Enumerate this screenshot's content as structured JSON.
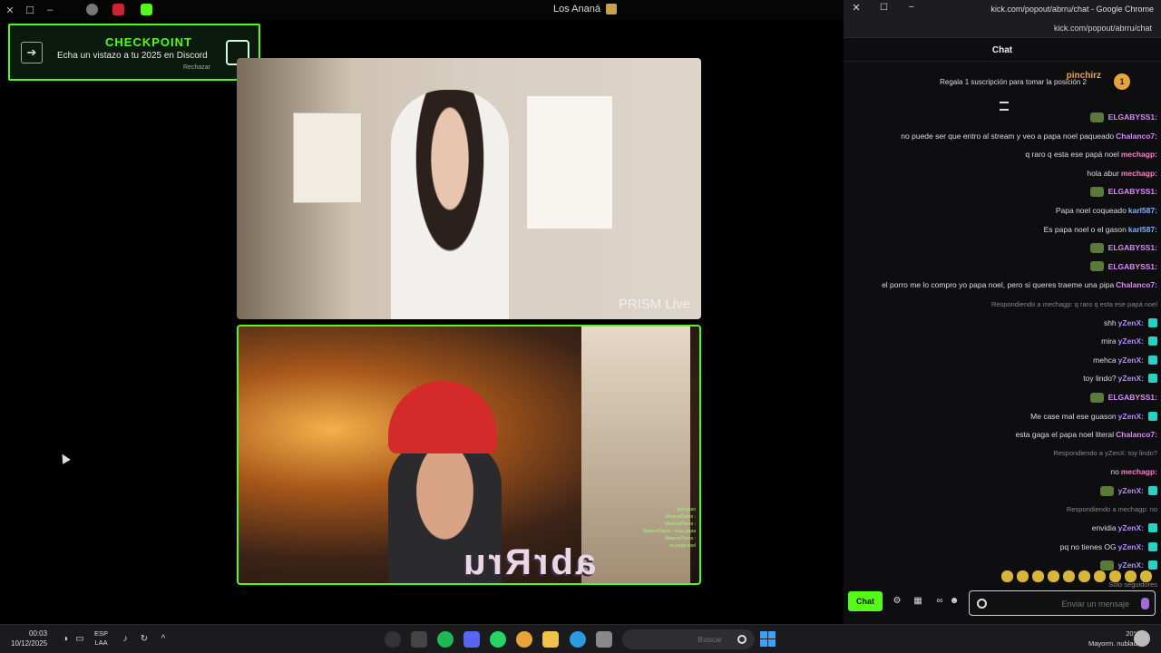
{
  "stream_window": {
    "title": "Los Ananá",
    "checkpoint": {
      "title": "CHECKPOINT",
      "subtitle": "Echa un vistazo a tu 2025 en Discord",
      "dismiss": "Rechazar"
    },
    "prism_label": "PRISM Live",
    "overlay_logo": "abrRru",
    "overlay_chat": [
      "que paso",
      "MaurooFlores :",
      "MaurooFlores :",
      "MaurooFlores : chau papa",
      "MaurooFlores :",
      "es papa noel"
    ]
  },
  "chrome": {
    "title": "kick.com/popout/abrru/chat - Google Chrome",
    "url": "kick.com/popout/abrru/chat"
  },
  "chat": {
    "header": "Chat",
    "gift": {
      "rank": "1",
      "user": "pinchirz",
      "text": "Regala 1 suscripción para tomar la posición 2"
    },
    "messages": [
      {
        "user": "ELGABYSS1:",
        "text": "",
        "emote": true,
        "color": "#d98cff",
        "badge": false
      },
      {
        "user": "Chalanco7:",
        "text": "no puede ser que entro al stream y veo a papa noel paqueado",
        "emote": false,
        "color": "#d98cff",
        "badge": false
      },
      {
        "user": "mechagp:",
        "text": "q raro q esta ese papá noel",
        "emote": false,
        "color": "#ff7ac8",
        "badge": false
      },
      {
        "user": "mechagp:",
        "text": "hola abur",
        "emote": false,
        "color": "#ff7ac8",
        "badge": false
      },
      {
        "user": "ELGABYSS1:",
        "text": "",
        "emote": true,
        "color": "#d98cff",
        "badge": false
      },
      {
        "user": "karl587:",
        "text": "Papa noel coqueado",
        "emote": false,
        "color": "#7fb0ff",
        "badge": false
      },
      {
        "user": "karl587:",
        "text": "Es papa noel o el gason",
        "emote": false,
        "color": "#7fb0ff",
        "badge": false
      },
      {
        "user": "ELGABYSS1:",
        "text": "",
        "emote": true,
        "color": "#d98cff",
        "badge": false
      },
      {
        "user": "ELGABYSS1:",
        "text": "",
        "emote": true,
        "color": "#d98cff",
        "badge": false
      },
      {
        "user": "Chalanco7:",
        "text": "el porro me lo compro yo papa noel, pero si queres traeme una pipa",
        "emote": false,
        "color": "#d98cff",
        "badge": false
      },
      {
        "reply": "Respondiendo a mechagp: q raro q esta ese papá noel"
      },
      {
        "user": "yZenX:",
        "text": "shh",
        "emote": false,
        "color": "#b48cff",
        "badge": true
      },
      {
        "user": "yZenX:",
        "text": "mira",
        "emote": false,
        "color": "#b48cff",
        "badge": true
      },
      {
        "user": "yZenX:",
        "text": "mehca",
        "emote": false,
        "color": "#b48cff",
        "badge": true
      },
      {
        "user": "yZenX:",
        "text": "toy lindo?",
        "emote": false,
        "color": "#b48cff",
        "badge": true
      },
      {
        "user": "ELGABYSS1:",
        "text": "",
        "emote": true,
        "color": "#d98cff",
        "badge": false
      },
      {
        "user": "yZenX:",
        "text": "Me case mal ese guason",
        "emote": false,
        "color": "#b48cff",
        "badge": true
      },
      {
        "user": "Chalanco7:",
        "text": "esta gaga el papa noel literal",
        "emote": false,
        "color": "#d98cff",
        "badge": false
      },
      {
        "reply": "Respondiendo a yZenX: toy lindo?"
      },
      {
        "user": "mechagp:",
        "text": "no",
        "emote": false,
        "color": "#ff7ac8",
        "badge": false
      },
      {
        "user": "yZenX:",
        "text": "",
        "emote": true,
        "color": "#b48cff",
        "badge": true
      },
      {
        "reply": "Respondiendo a mechagp: no"
      },
      {
        "user": "yZenX:",
        "text": "envidia",
        "emote": false,
        "color": "#b48cff",
        "badge": true
      },
      {
        "user": "yZenX:",
        "text": "pq no tienes OG",
        "emote": false,
        "color": "#b48cff",
        "badge": true
      },
      {
        "user": "yZenX:",
        "text": "",
        "emote": true,
        "color": "#b48cff",
        "badge": true
      },
      {
        "system": "Solo seguidores"
      }
    ],
    "input_placeholder": "Enviar un mensaje",
    "send_label": "Chat"
  },
  "taskbar": {
    "time": "00:03",
    "date": "10/12/2025",
    "lang_top": "ESP",
    "lang_bottom": "LAA",
    "search_placeholder": "Buscar",
    "weather_temp": "20°C",
    "weather_desc": "Mayorm. nublado"
  },
  "colors": {
    "kick_green": "#53fc18",
    "background": "#0e0e10"
  }
}
